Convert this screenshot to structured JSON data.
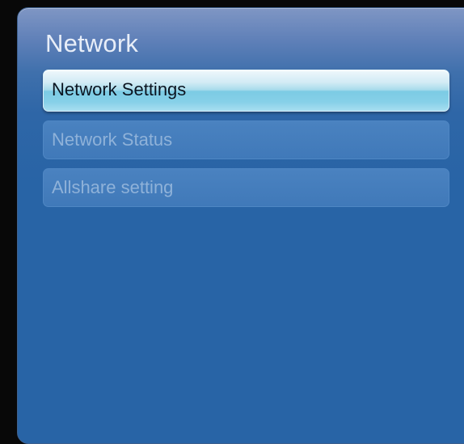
{
  "panel": {
    "title": "Network"
  },
  "menu": {
    "items": [
      {
        "label": "Network Settings",
        "selected": true
      },
      {
        "label": "Network Status",
        "selected": false
      },
      {
        "label": "Allshare setting",
        "selected": false
      }
    ]
  },
  "colors": {
    "background": "#080808",
    "panel": "#2864a6",
    "selected_highlight": "#86d0e8",
    "item_text_inactive": "#8fb2d9"
  }
}
